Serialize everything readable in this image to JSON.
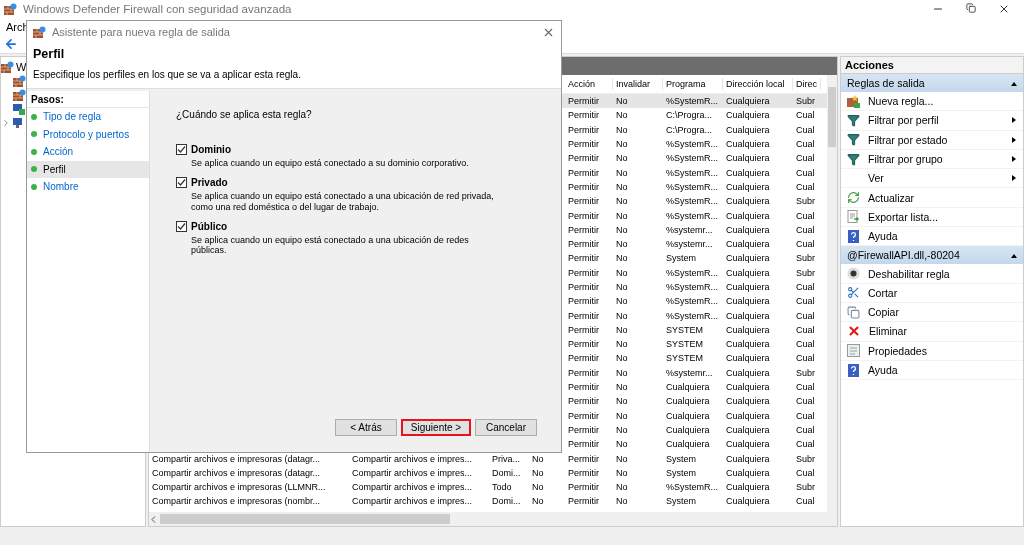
{
  "window": {
    "title": "Windows Defender Firewall con seguridad avanzada"
  },
  "menu": [
    "Arch"
  ],
  "tree": {
    "root": "W"
  },
  "table": {
    "columns": [
      "Acción",
      "Invalidar",
      "Programa",
      "Dirección local",
      "Direc"
    ],
    "rows": [
      {
        "selected": true,
        "action": "Permitir",
        "override": "No",
        "program": "%SystemR...",
        "local": "Cualquiera",
        "remote": "Subr"
      },
      {
        "selected": false,
        "action": "Permitir",
        "override": "No",
        "program": "C:\\Progra...",
        "local": "Cualquiera",
        "remote": "Cual"
      },
      {
        "selected": false,
        "action": "Permitir",
        "override": "No",
        "program": "C:\\Progra...",
        "local": "Cualquiera",
        "remote": "Cual"
      },
      {
        "selected": false,
        "action": "Permitir",
        "override": "No",
        "program": "%SystemR...",
        "local": "Cualquiera",
        "remote": "Cual"
      },
      {
        "selected": false,
        "action": "Permitir",
        "override": "No",
        "program": "%SystemR...",
        "local": "Cualquiera",
        "remote": "Cual"
      },
      {
        "selected": false,
        "action": "Permitir",
        "override": "No",
        "program": "%SystemR...",
        "local": "Cualquiera",
        "remote": "Cual"
      },
      {
        "selected": false,
        "action": "Permitir",
        "override": "No",
        "program": "%SystemR...",
        "local": "Cualquiera",
        "remote": "Cual"
      },
      {
        "selected": false,
        "action": "Permitir",
        "override": "No",
        "program": "%SystemR...",
        "local": "Cualquiera",
        "remote": "Subr"
      },
      {
        "selected": false,
        "action": "Permitir",
        "override": "No",
        "program": "%SystemR...",
        "local": "Cualquiera",
        "remote": "Cual"
      },
      {
        "selected": false,
        "action": "Permitir",
        "override": "No",
        "program": "%systemr...",
        "local": "Cualquiera",
        "remote": "Cual"
      },
      {
        "selected": false,
        "action": "Permitir",
        "override": "No",
        "program": "%systemr...",
        "local": "Cualquiera",
        "remote": "Cual"
      },
      {
        "selected": false,
        "action": "Permitir",
        "override": "No",
        "program": "System",
        "local": "Cualquiera",
        "remote": "Subr"
      },
      {
        "selected": false,
        "action": "Permitir",
        "override": "No",
        "program": "%SystemR...",
        "local": "Cualquiera",
        "remote": "Subr"
      },
      {
        "selected": false,
        "action": "Permitir",
        "override": "No",
        "program": "%SystemR...",
        "local": "Cualquiera",
        "remote": "Cual"
      },
      {
        "selected": false,
        "action": "Permitir",
        "override": "No",
        "program": "%SystemR...",
        "local": "Cualquiera",
        "remote": "Cual"
      },
      {
        "selected": false,
        "action": "Permitir",
        "override": "No",
        "program": "%SystemR...",
        "local": "Cualquiera",
        "remote": "Cual"
      },
      {
        "selected": false,
        "action": "Permitir",
        "override": "No",
        "program": "SYSTEM",
        "local": "Cualquiera",
        "remote": "Cual"
      },
      {
        "selected": false,
        "action": "Permitir",
        "override": "No",
        "program": "SYSTEM",
        "local": "Cualquiera",
        "remote": "Cual"
      },
      {
        "selected": false,
        "action": "Permitir",
        "override": "No",
        "program": "SYSTEM",
        "local": "Cualquiera",
        "remote": "Cual"
      },
      {
        "selected": false,
        "action": "Permitir",
        "override": "No",
        "program": "%systemr...",
        "local": "Cualquiera",
        "remote": "Subr"
      },
      {
        "selected": false,
        "action": "Permitir",
        "override": "No",
        "program": "Cualquiera",
        "local": "Cualquiera",
        "remote": "Cual"
      },
      {
        "selected": false,
        "action": "Permitir",
        "override": "No",
        "program": "Cualquiera",
        "local": "Cualquiera",
        "remote": "Cual"
      },
      {
        "selected": false,
        "action": "Permitir",
        "override": "No",
        "program": "Cualquiera",
        "local": "Cualquiera",
        "remote": "Cual"
      },
      {
        "selected": false,
        "action": "Permitir",
        "override": "No",
        "program": "Cualquiera",
        "local": "Cualquiera",
        "remote": "Cual"
      },
      {
        "selected": false,
        "action": "Permitir",
        "override": "No",
        "program": "Cualquiera",
        "local": "Cualquiera",
        "remote": "Cual"
      },
      {
        "selected": false,
        "name": "Compartir archivos e impresoras (datagr...",
        "group": "Compartir archivos e impres...",
        "profile": "Priva...",
        "enabled": "No",
        "action": "Permitir",
        "override": "No",
        "program": "System",
        "local": "Cualquiera",
        "remote": "Subr"
      },
      {
        "selected": false,
        "name": "Compartir archivos e impresoras (datagr...",
        "group": "Compartir archivos e impres...",
        "profile": "Domi...",
        "enabled": "No",
        "action": "Permitir",
        "override": "No",
        "program": "System",
        "local": "Cualquiera",
        "remote": "Cual"
      },
      {
        "selected": false,
        "name": "Compartir archivos e impresoras (LLMNR...",
        "group": "Compartir archivos e impres...",
        "profile": "Todo",
        "enabled": "No",
        "action": "Permitir",
        "override": "No",
        "program": "%SystemR...",
        "local": "Cualquiera",
        "remote": "Subr"
      },
      {
        "selected": false,
        "name": "Compartir archivos e impresoras (nombr...",
        "group": "Compartir archivos e impres...",
        "profile": "Domi...",
        "enabled": "No",
        "action": "Permitir",
        "override": "No",
        "program": "System",
        "local": "Cualquiera",
        "remote": "Cual"
      }
    ]
  },
  "actions": {
    "title": "Acciones",
    "sections": [
      {
        "title": "Reglas de salida",
        "expanded": true,
        "items": [
          {
            "label": "Nueva regla...",
            "kind": "new",
            "submenu": false
          },
          {
            "label": "Filtrar por perfil",
            "kind": "filter",
            "submenu": true
          },
          {
            "label": "Filtrar por estado",
            "kind": "filter",
            "submenu": true
          },
          {
            "label": "Filtrar por grupo",
            "kind": "filter",
            "submenu": true
          },
          {
            "label": "Ver",
            "kind": "none",
            "submenu": true
          },
          {
            "label": "Actualizar",
            "kind": "refresh",
            "submenu": false
          },
          {
            "label": "Exportar lista...",
            "kind": "export",
            "submenu": false
          },
          {
            "label": "Ayuda",
            "kind": "help",
            "submenu": false
          }
        ]
      },
      {
        "title": "@FirewallAPI.dll,-80204",
        "expanded": true,
        "items": [
          {
            "label": "Deshabilitar regla",
            "kind": "disable",
            "submenu": false
          },
          {
            "label": "Cortar",
            "kind": "cut",
            "submenu": false
          },
          {
            "label": "Copiar",
            "kind": "copy",
            "submenu": false
          },
          {
            "label": "Eliminar",
            "kind": "delete",
            "submenu": false
          },
          {
            "label": "Propiedades",
            "kind": "properties",
            "submenu": false
          },
          {
            "label": "Ayuda",
            "kind": "help",
            "submenu": false
          }
        ]
      }
    ]
  },
  "dialog": {
    "title": "Asistente para nueva regla de salida",
    "heading": "Perfil",
    "subtitle": "Especifique los perfiles en los que se va a aplicar esta regla.",
    "steps_label": "Pasos:",
    "steps": [
      {
        "label": "Tipo de regla",
        "selected": false
      },
      {
        "label": "Protocolo y puertos",
        "selected": false
      },
      {
        "label": "Acción",
        "selected": false
      },
      {
        "label": "Perfil",
        "selected": true
      },
      {
        "label": "Nombre",
        "selected": false
      }
    ],
    "question": "¿Cuándo se aplica esta regla?",
    "profiles": [
      {
        "label": "Dominio",
        "checked": true,
        "description": "Se aplica cuando un equipo está conectado a su dominio corporativo."
      },
      {
        "label": "Privado",
        "checked": true,
        "description": "Se aplica cuando un equipo está conectado a una ubicación de red privada, como una red doméstica o del lugar de trabajo."
      },
      {
        "label": "Público",
        "checked": true,
        "description": "Se aplica cuando un equipo está conectado a una ubicación de redes públicas."
      }
    ],
    "buttons": [
      {
        "label": "< Atrás",
        "highlighted": false
      },
      {
        "label": "Siguiente >",
        "highlighted": true
      },
      {
        "label": "Cancelar",
        "highlighted": false
      }
    ]
  }
}
